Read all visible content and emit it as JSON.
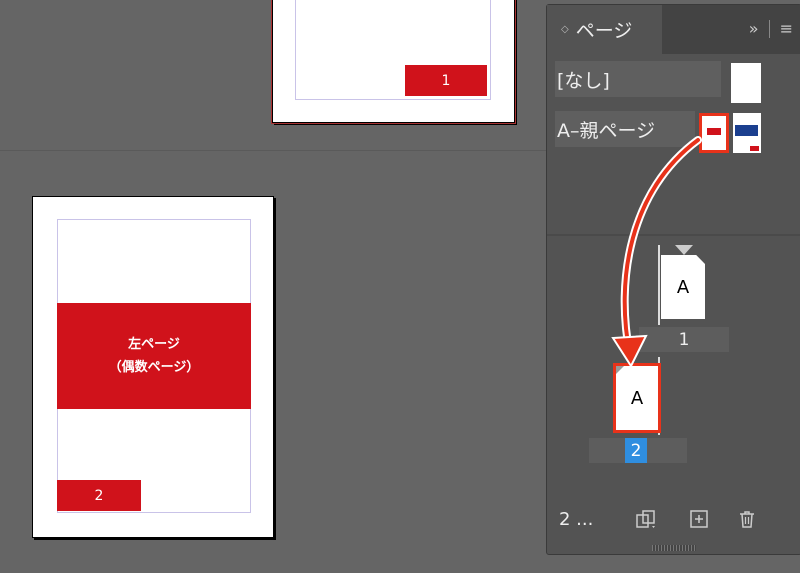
{
  "canvas": {
    "page1": {
      "number": "1"
    },
    "page2": {
      "title_line1": "左ページ",
      "title_line2": "（偶数ページ）",
      "number": "2"
    }
  },
  "panel": {
    "tab_label": "ページ",
    "tab_chevron": "◇",
    "overflow_label": "»",
    "menu_label": "≡",
    "masters": [
      {
        "label": "[なし]"
      },
      {
        "label": "A–親ページ"
      }
    ],
    "pages": [
      {
        "master_letter": "A",
        "number": "1"
      },
      {
        "master_letter": "A",
        "number": "2",
        "selected": true
      }
    ],
    "footer": {
      "page_count": "2 ...",
      "icons": [
        "page-size-icon",
        "new-page-icon",
        "trash-icon"
      ]
    }
  },
  "colors": {
    "accent_red": "#d0121b",
    "arrow": "#e8321a",
    "selection": "#2f8ee0"
  }
}
